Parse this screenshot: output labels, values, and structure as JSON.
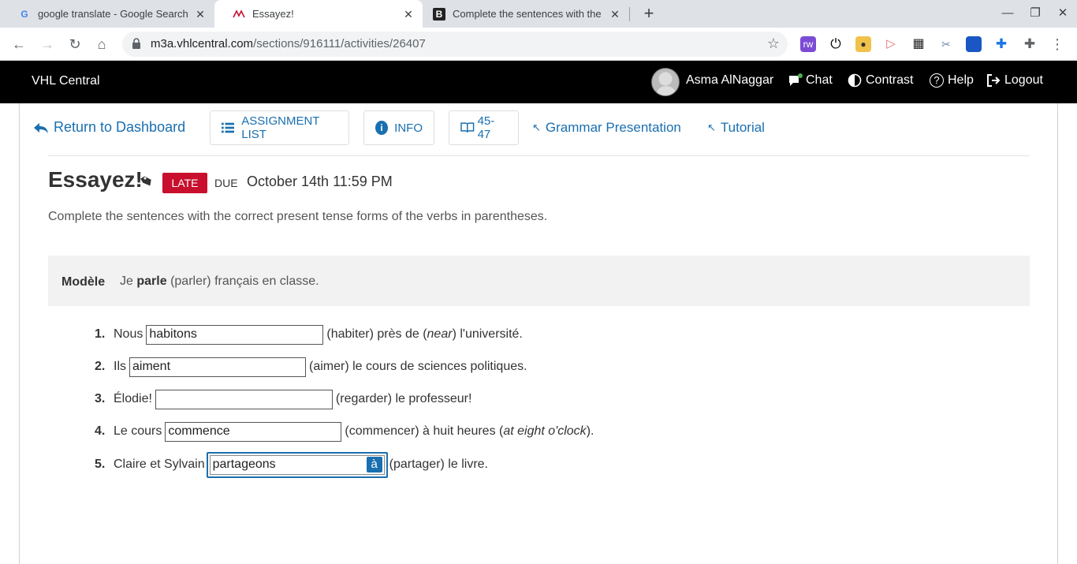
{
  "browser": {
    "tabs": [
      {
        "title": "google translate - Google Search",
        "favicon": "G"
      },
      {
        "title": "Essayez!",
        "favicon": "vhl-icon"
      },
      {
        "title": "Complete the sentences with the",
        "favicon": "B"
      }
    ],
    "url_domain": "m3a.vhlcentral.com",
    "url_path": "/sections/916111/activities/26407"
  },
  "header": {
    "brand": "VHL Central",
    "user_name": "Asma AlNaggar",
    "chat": "Chat",
    "contrast": "Contrast",
    "help": "Help",
    "logout": "Logout"
  },
  "nav": {
    "return": "Return to Dashboard",
    "assignment_list": "ASSIGNMENT LIST",
    "info": "INFO",
    "pages": "45-47",
    "grammar": "Grammar Presentation",
    "tutorial": "Tutorial"
  },
  "activity": {
    "title": "Essayez!",
    "late": "LATE",
    "due_label": "DUE",
    "due_date": "October 14th 11:59 PM",
    "instructions": "Complete the sentences with the correct present tense forms of the verbs in parentheses.",
    "model_label": "Modèle",
    "model_pre": "Je",
    "model_bold": "parle",
    "model_post": "(parler) français en classe.",
    "accent_button": "à"
  },
  "questions": [
    {
      "num": "1.",
      "before": "Nous",
      "value": "habitons",
      "after_a": "(habiter) près de (",
      "after_em": "near",
      "after_b": ") l'université."
    },
    {
      "num": "2.",
      "before": "Ils",
      "value": "aiment",
      "after_a": "(aimer) le cours de sciences politiques.",
      "after_em": "",
      "after_b": ""
    },
    {
      "num": "3.",
      "before": "Élodie!",
      "value": "",
      "after_a": "(regarder) le professeur!",
      "after_em": "",
      "after_b": ""
    },
    {
      "num": "4.",
      "before": "Le cours",
      "value": "commence",
      "after_a": "(commencer) à huit heures (",
      "after_em": "at eight o'clock",
      "after_b": ")."
    },
    {
      "num": "5.",
      "before": "Claire et Sylvain",
      "value": "partageons",
      "after_a": "(partager) le livre.",
      "after_em": "",
      "after_b": ""
    }
  ]
}
